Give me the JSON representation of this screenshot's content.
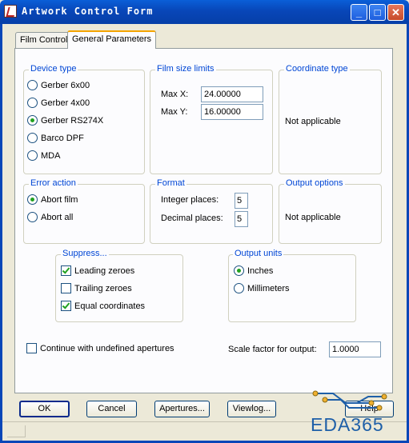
{
  "window": {
    "title": "Artwork Control Form",
    "minimize_glyph": "_",
    "maximize_glyph": "□",
    "close_glyph": "✕"
  },
  "tabs": [
    {
      "label": "Film Control",
      "active": false
    },
    {
      "label": "General Parameters",
      "active": true
    }
  ],
  "device_type": {
    "legend": "Device type",
    "options": [
      {
        "label": "Gerber 6x00",
        "selected": false
      },
      {
        "label": "Gerber 4x00",
        "selected": false
      },
      {
        "label": "Gerber RS274X",
        "selected": true
      },
      {
        "label": "Barco DPF",
        "selected": false
      },
      {
        "label": "MDA",
        "selected": false
      }
    ]
  },
  "film_size_limits": {
    "legend": "Film size limits",
    "max_x_label": "Max X:",
    "max_x_value": "24.00000",
    "max_y_label": "Max Y:",
    "max_y_value": "16.00000"
  },
  "coordinate_type": {
    "legend": "Coordinate type",
    "text": "Not applicable"
  },
  "error_action": {
    "legend": "Error action",
    "options": [
      {
        "label": "Abort film",
        "selected": true
      },
      {
        "label": "Abort all",
        "selected": false
      }
    ]
  },
  "format": {
    "legend": "Format",
    "integer_label": "Integer places:",
    "integer_value": "5",
    "decimal_label": "Decimal places:",
    "decimal_value": "5"
  },
  "output_options": {
    "legend": "Output options",
    "text": "Not applicable"
  },
  "suppress": {
    "legend": "Suppress...",
    "options": [
      {
        "label": "Leading zeroes",
        "checked": true
      },
      {
        "label": "Trailing zeroes",
        "checked": false
      },
      {
        "label": "Equal coordinates",
        "checked": true
      }
    ]
  },
  "output_units": {
    "legend": "Output units",
    "options": [
      {
        "label": "Inches",
        "selected": true
      },
      {
        "label": "Millimeters",
        "selected": false
      }
    ]
  },
  "continue_undefined": {
    "label": "Continue with undefined apertures",
    "checked": false
  },
  "scale_factor": {
    "label": "Scale factor for output:",
    "value": "1.0000"
  },
  "buttons": {
    "ok": "OK",
    "cancel": "Cancel",
    "apertures": "Apertures...",
    "viewlog": "Viewlog...",
    "help": "Help"
  },
  "watermark": {
    "text": "EDA365"
  },
  "colors": {
    "titlebar": "#0846b8",
    "legend_text": "#0046d5",
    "face": "#ece9d8",
    "check_green": "#21a121"
  }
}
